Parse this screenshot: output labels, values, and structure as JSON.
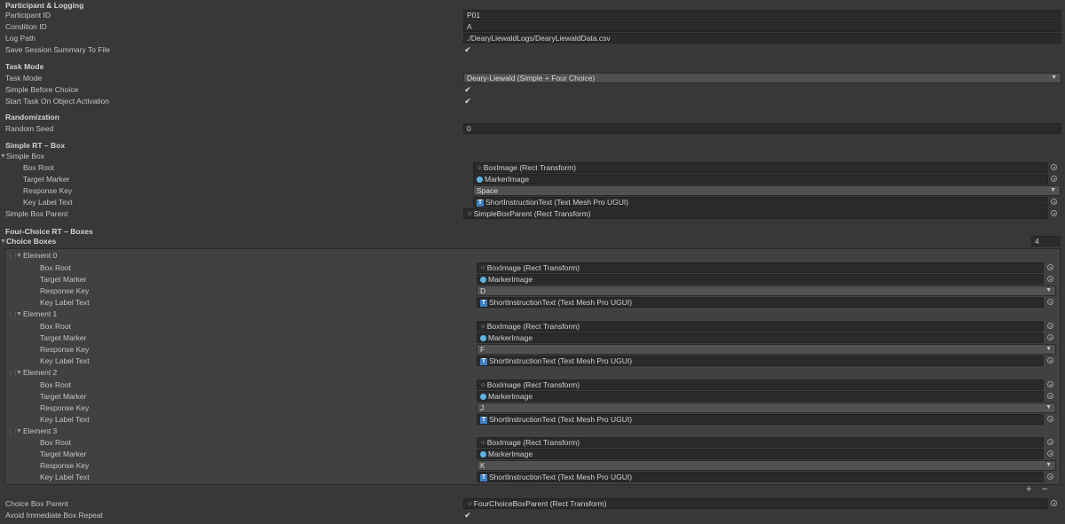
{
  "sections": {
    "logging": "Participant & Logging",
    "task": "Task Mode",
    "random": "Randomization",
    "simple": "Simple RT – Box",
    "four": "Four-Choice RT – Boxes"
  },
  "fields": {
    "participant_id": {
      "label": "Participant ID",
      "value": "P01"
    },
    "condition_id": {
      "label": "Condition ID",
      "value": "A"
    },
    "log_path": {
      "label": "Log Path",
      "value": "./DearyLiewaldLogs/DearyLiewaldData.csv"
    },
    "save_summary": {
      "label": "Save Session Summary To File",
      "checked": true
    },
    "task_mode": {
      "label": "Task Mode",
      "value": "Deary-Liewald (Simple + Four Choice)"
    },
    "simple_before_choice": {
      "label": "Simple Before Choice",
      "checked": true
    },
    "start_on_activation": {
      "label": "Start Task On Object Activation",
      "checked": true
    },
    "random_seed": {
      "label": "Random Seed",
      "value": "0"
    },
    "simple_box_parent": {
      "label": "Simple Box Parent",
      "value": "SimpleBoxParent (Rect Transform)"
    },
    "choice_box_parent": {
      "label": "Choice Box Parent",
      "value": "FourChoiceBoxParent (Rect Transform)"
    },
    "avoid_repeat": {
      "label": "Avoid Immediate Box Repeat",
      "checked": true
    }
  },
  "simple_box": {
    "label": "Simple Box",
    "box_root": {
      "label": "Box Root",
      "value": "BoxImage (Rect Transform)"
    },
    "target_marker": {
      "label": "Target Marker",
      "value": "MarkerImage"
    },
    "response_key": {
      "label": "Response Key",
      "value": "Space"
    },
    "key_label_text": {
      "label": "Key Label Text",
      "value": "ShortInstructionText (Text Mesh Pro UGUI)"
    }
  },
  "choice_boxes": {
    "label": "Choice Boxes",
    "size": "4",
    "sub_labels": {
      "box_root": "Box Root",
      "target_marker": "Target Marker",
      "response_key": "Response Key",
      "key_label_text": "Key Label Text"
    },
    "elements": [
      {
        "label": "Element 0",
        "box_root": "BoxImage (Rect Transform)",
        "target_marker": "MarkerImage",
        "response_key": "D",
        "key_label_text": "ShortInstructionText (Text Mesh Pro UGUI)"
      },
      {
        "label": "Element 1",
        "box_root": "BoxImage (Rect Transform)",
        "target_marker": "MarkerImage",
        "response_key": "F",
        "key_label_text": "ShortInstructionText (Text Mesh Pro UGUI)"
      },
      {
        "label": "Element 2",
        "box_root": "BoxImage (Rect Transform)",
        "target_marker": "MarkerImage",
        "response_key": "J",
        "key_label_text": "ShortInstructionText (Text Mesh Pro UGUI)"
      },
      {
        "label": "Element 3",
        "box_root": "BoxImage (Rect Transform)",
        "target_marker": "MarkerImage",
        "response_key": "K",
        "key_label_text": "ShortInstructionText (Text Mesh Pro UGUI)"
      }
    ],
    "add_label": "+",
    "remove_label": "−"
  },
  "icons": {
    "check": "✔",
    "dropdown_arrow": "▼",
    "foldout_open": "▼",
    "rect_transform": "⁘"
  }
}
